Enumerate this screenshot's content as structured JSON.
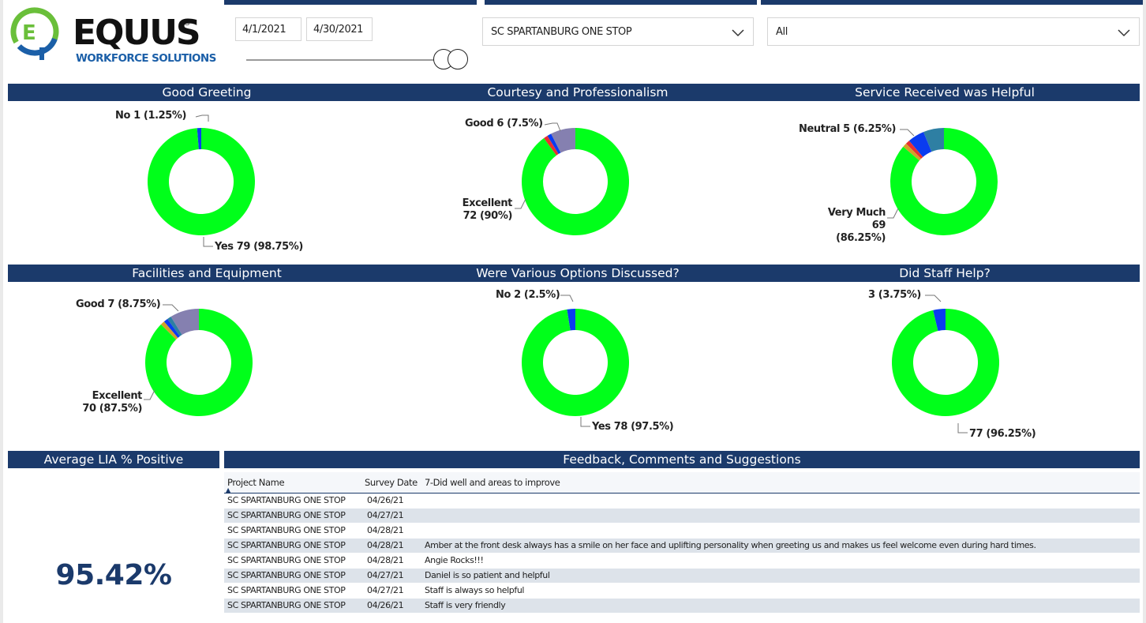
{
  "header": {
    "logo_word": "EQUUS",
    "logo_sub": "WORKFORCE SOLUTIONS",
    "logo_mark": "EQ",
    "start_date": "4/1/2021",
    "end_date": "4/30/2021",
    "location_value": "SC SPARTANBURG ONE STOP",
    "filter_value": "All"
  },
  "colors": {
    "navy": "#1b3a6b",
    "green": "#00ff1a",
    "blue": "#0a3cf0",
    "purple": "#8580b0",
    "teal": "#2e7fa3",
    "red": "#e83030",
    "orange": "#d4a02a"
  },
  "chart_data": [
    {
      "type": "pie",
      "title": "Good Greeting",
      "slices": [
        {
          "name": "Yes",
          "value": 79,
          "pct": "98.75%",
          "label": "Yes 79 (98.75%)",
          "color": "#00ff1a"
        },
        {
          "name": "No",
          "value": 1,
          "pct": "1.25%",
          "label": "No 1 (1.25%)",
          "color": "#0a3cf0"
        }
      ]
    },
    {
      "type": "pie",
      "title": "Courtesy and Professionalism",
      "slices": [
        {
          "name": "Excellent",
          "value": 72,
          "pct": "90%",
          "label": "Excellent 72 (90%)",
          "color": "#00ff1a"
        },
        {
          "name": "Good",
          "value": 6,
          "pct": "7.5%",
          "label": "Good 6 (7.5%)",
          "color": "#8580b0"
        },
        {
          "name": "",
          "value": 1,
          "color": "#0a3cf0"
        },
        {
          "name": "",
          "value": 1,
          "color": "#e83030"
        }
      ]
    },
    {
      "type": "pie",
      "title": "Service Received was Helpful",
      "slices": [
        {
          "name": "Very Much",
          "value": 69,
          "pct": "86.25%",
          "label": "Very Much 69 (86.25%)",
          "color": "#00ff1a"
        },
        {
          "name": "Neutral",
          "value": 5,
          "pct": "6.25%",
          "label": "Neutral 5 (6.25%)",
          "color": "#2e7fa3"
        },
        {
          "name": "",
          "value": 4,
          "color": "#0a3cf0"
        },
        {
          "name": "",
          "value": 1,
          "color": "#e83030"
        },
        {
          "name": "",
          "value": 1,
          "color": "#d4a02a"
        }
      ]
    },
    {
      "type": "pie",
      "title": "Facilities and Equipment",
      "slices": [
        {
          "name": "Excellent",
          "value": 70,
          "pct": "87.5%",
          "label": "Excellent 70 (87.5%)",
          "color": "#00ff1a"
        },
        {
          "name": "Good",
          "value": 7,
          "pct": "8.75%",
          "label": "Good 7 (8.75%)",
          "color": "#8580b0"
        },
        {
          "name": "",
          "value": 1,
          "color": "#2e7fa3"
        },
        {
          "name": "",
          "value": 1,
          "color": "#0a3cf0"
        },
        {
          "name": "",
          "value": 1,
          "color": "#d4a02a"
        }
      ]
    },
    {
      "type": "pie",
      "title": "Were Various Options Discussed?",
      "slices": [
        {
          "name": "Yes",
          "value": 78,
          "pct": "97.5%",
          "label": "Yes 78 (97.5%)",
          "color": "#00ff1a"
        },
        {
          "name": "No",
          "value": 2,
          "pct": "2.5%",
          "label": "No 2 (2.5%)",
          "color": "#0a3cf0"
        }
      ]
    },
    {
      "type": "pie",
      "title": "Did Staff Help?",
      "slices": [
        {
          "name": "",
          "value": 77,
          "pct": "96.25%",
          "label": "77 (96.25%)",
          "color": "#00ff1a"
        },
        {
          "name": "",
          "value": 3,
          "pct": "3.75%",
          "label": "3 (3.75%)",
          "color": "#0a3cf0"
        }
      ]
    }
  ],
  "kpi": {
    "title": "Average LIA % Positive",
    "value": "95.42%"
  },
  "feedback": {
    "title": "Feedback, Comments and Suggestions",
    "columns": [
      "Project Name",
      "Survey Date",
      "7-Did well and areas to improve"
    ],
    "rows": [
      [
        "SC SPARTANBURG ONE STOP",
        "04/26/21",
        ""
      ],
      [
        "SC SPARTANBURG ONE STOP",
        "04/27/21",
        ""
      ],
      [
        "SC SPARTANBURG ONE STOP",
        "04/28/21",
        ""
      ],
      [
        "SC SPARTANBURG ONE STOP",
        "04/28/21",
        "Amber at the front desk always has a smile on her face and uplifting personality when greeting us and makes us feel welcome even during hard times."
      ],
      [
        "SC SPARTANBURG ONE STOP",
        "04/28/21",
        "Angie Rocks!!!"
      ],
      [
        "SC SPARTANBURG ONE STOP",
        "04/27/21",
        "Daniel is so patient and helpful"
      ],
      [
        "SC SPARTANBURG ONE STOP",
        "04/27/21",
        "Staff is always so helpful"
      ],
      [
        "SC SPARTANBURG ONE STOP",
        "04/26/21",
        "Staff is very friendly"
      ]
    ]
  }
}
